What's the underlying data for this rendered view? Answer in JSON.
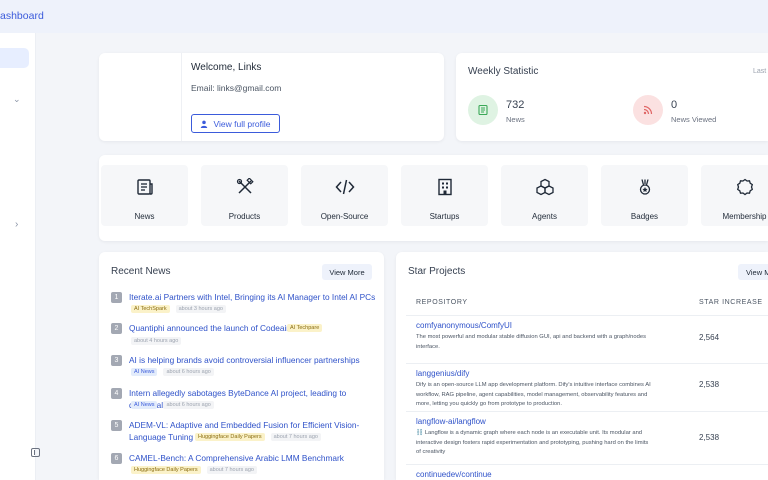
{
  "breadcrumb": "ashboard",
  "profile": {
    "welcome": "Welcome, Links",
    "email": "Email: links@gmail.com",
    "button": "View full profile"
  },
  "weekly": {
    "title": "Weekly Statistic",
    "period": "Last",
    "news_value": "732",
    "news_label": "News",
    "viewed_value": "0",
    "viewed_label": "News Viewed"
  },
  "tiles": [
    {
      "label": "News",
      "icon": "news-icon"
    },
    {
      "label": "Products",
      "icon": "tools-icon"
    },
    {
      "label": "Open-Source",
      "icon": "code-icon"
    },
    {
      "label": "Startups",
      "icon": "building-icon"
    },
    {
      "label": "Agents",
      "icon": "cubes-icon"
    },
    {
      "label": "Badges",
      "icon": "medal-icon"
    },
    {
      "label": "Membership",
      "icon": "membership-icon"
    }
  ],
  "news": {
    "title": "Recent News",
    "view_more": "View More",
    "items": [
      {
        "num": "1",
        "title": "Iterate.ai Partners with Intel, Bringing its AI Manager to Intel AI PCs",
        "tag": "AI TechSpark",
        "tag_style": "yellow",
        "time": "about 3 hours ago"
      },
      {
        "num": "2",
        "title": "Quantiphi announced the launch of Codeaira",
        "tag": "AI Techpare",
        "tag_style": "yellow",
        "time": "about 4 hours ago"
      },
      {
        "num": "3",
        "title": "AI is helping brands avoid controversial influencer partnerships",
        "tag": "AI News",
        "tag_style": "blue",
        "time": "about 6 hours ago"
      },
      {
        "num": "4",
        "title": "Intern allegedly sabotages ByteDance AI project, leading to dismissal",
        "tag": "AI News",
        "tag_style": "blue",
        "time": "about 6 hours ago"
      },
      {
        "num": "5",
        "title": "ADEM-VL: Adaptive and Embedded Fusion for Efficient Vision-Language Tuning",
        "tag": "Huggingface Daily Papers",
        "tag_style": "yellow",
        "time": "about 7 hours ago"
      },
      {
        "num": "6",
        "title": "CAMEL-Bench: A Comprehensive Arabic LMM Benchmark",
        "tag": "Huggingface Daily Papers",
        "tag_style": "yellow",
        "time": "about 7 hours ago"
      }
    ]
  },
  "star": {
    "title": "Star Projects",
    "view_more": "View M",
    "col_repo": "REPOSITORY",
    "col_stars": "STAR INCREASE",
    "rows": [
      {
        "name": "comfyanonymous/ComfyUI",
        "desc": "The most powerful and modular stable diffusion GUI, api and backend with a graph/nodes interface.",
        "stars": "2,564"
      },
      {
        "name": "langgenius/dify",
        "desc": "Dify is an open-source LLM app development platform. Dify's intuitive interface combines AI workflow, RAG pipeline, agent capabilities, model management, observability features and more, letting you quickly go from prototype to production.",
        "stars": "2,538"
      },
      {
        "name": "langflow-ai/langflow",
        "desc": "⛓️ Langflow is a dynamic graph where each node is an executable unit. Its modular and interactive design fosters rapid experimentation and prototyping, pushing hard on the limits of creativity",
        "stars": "2,538"
      },
      {
        "name": "continuedev/continue",
        "desc": "",
        "stars": ""
      }
    ]
  }
}
